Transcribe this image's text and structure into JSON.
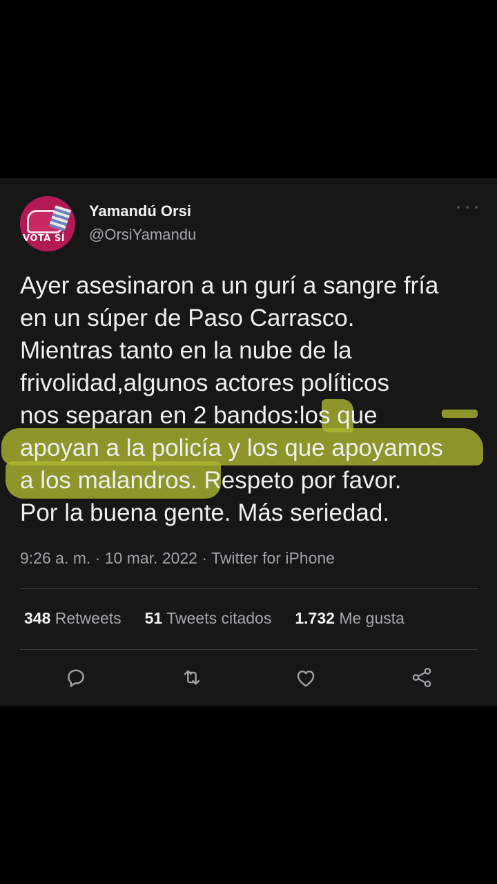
{
  "tweet": {
    "author": {
      "display_name": "Yamandú Orsi",
      "handle": "@OrsiYamandu",
      "avatar_text": "VOTÁ SÍ"
    },
    "text_lines": [
      "Ayer asesinaron a un gurí a sangre fría",
      "en un súper de Paso Carrasco.",
      "Mientras tanto en la nube de la",
      "frivolidad,algunos actores políticos",
      "nos separan en 2 bandos:los que",
      "apoyan a la policía y los que apoyamos",
      "a los malandros. Respeto por favor.",
      "Por la buena gente. Más seriedad."
    ],
    "timestamp": "9:26 a. m. · 10 mar. 2022 · Twitter for iPhone",
    "stats": {
      "retweets_count": "348",
      "retweets_label": "Retweets",
      "quotes_count": "51",
      "quotes_label": "Tweets citados",
      "likes_count": "1.732",
      "likes_label": "Me gusta"
    },
    "actions": [
      "reply-icon",
      "retweet-icon",
      "like-icon",
      "share-icon"
    ]
  },
  "colors": {
    "highlight": "#b0b830",
    "avatar_bg": "#b31a55",
    "card_bg": "#171717"
  }
}
